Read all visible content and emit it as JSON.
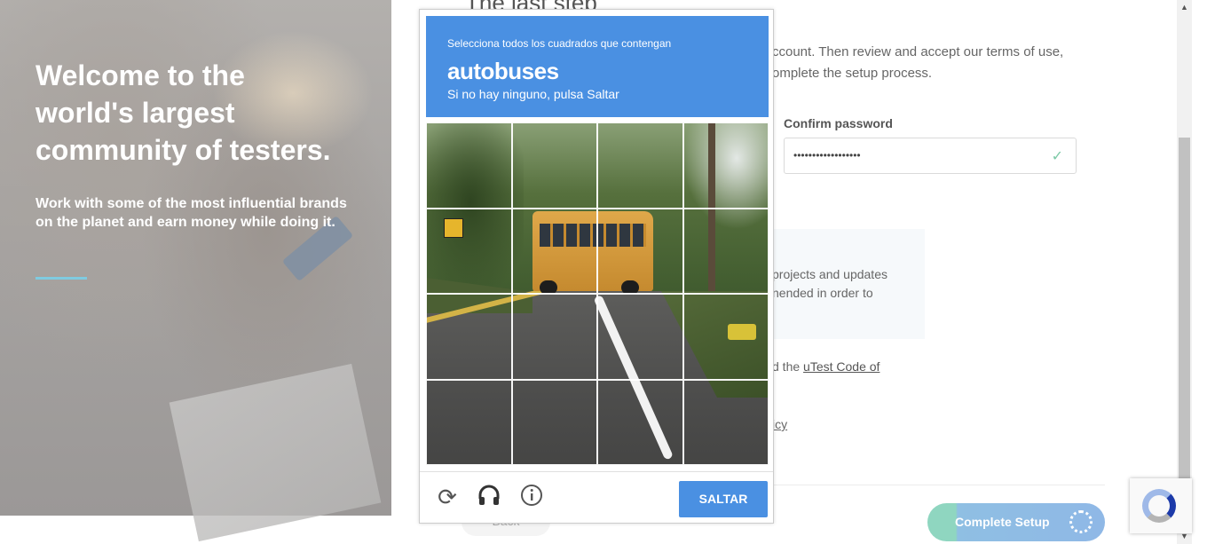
{
  "hero": {
    "title": "Welcome to the\nworld's largest\ncommunity of testers.",
    "subtitle": "Work with some of the most influential brands on the planet and earn money while doing it."
  },
  "form": {
    "step_title": "The last step",
    "intro": "ccount. Then review and accept our terms of use, omplete the setup process.",
    "confirm_password_label": "Confirm password",
    "confirm_password_value": "••••••••••••••••••",
    "updates_text": "projects and updates nended in order to",
    "coc_prefix": "d the ",
    "coc_link": "uTest Code of",
    "policy_link": "icy",
    "back_label": "Back",
    "complete_label": "Complete Setup"
  },
  "captcha": {
    "instruction": "Selecciona todos los cuadrados que contengan",
    "target": "autobuses",
    "hint": "Si no hay ninguno, pulsa Saltar",
    "skip_label": "SALTAR",
    "icons": [
      "reload-icon",
      "audio-icon",
      "info-icon"
    ],
    "grid": {
      "rows": 4,
      "cols": 4
    }
  },
  "colors": {
    "captcha_blue": "#4a90e2",
    "accent_line": "#7fcbe0",
    "check_green": "#7cc9a6"
  }
}
